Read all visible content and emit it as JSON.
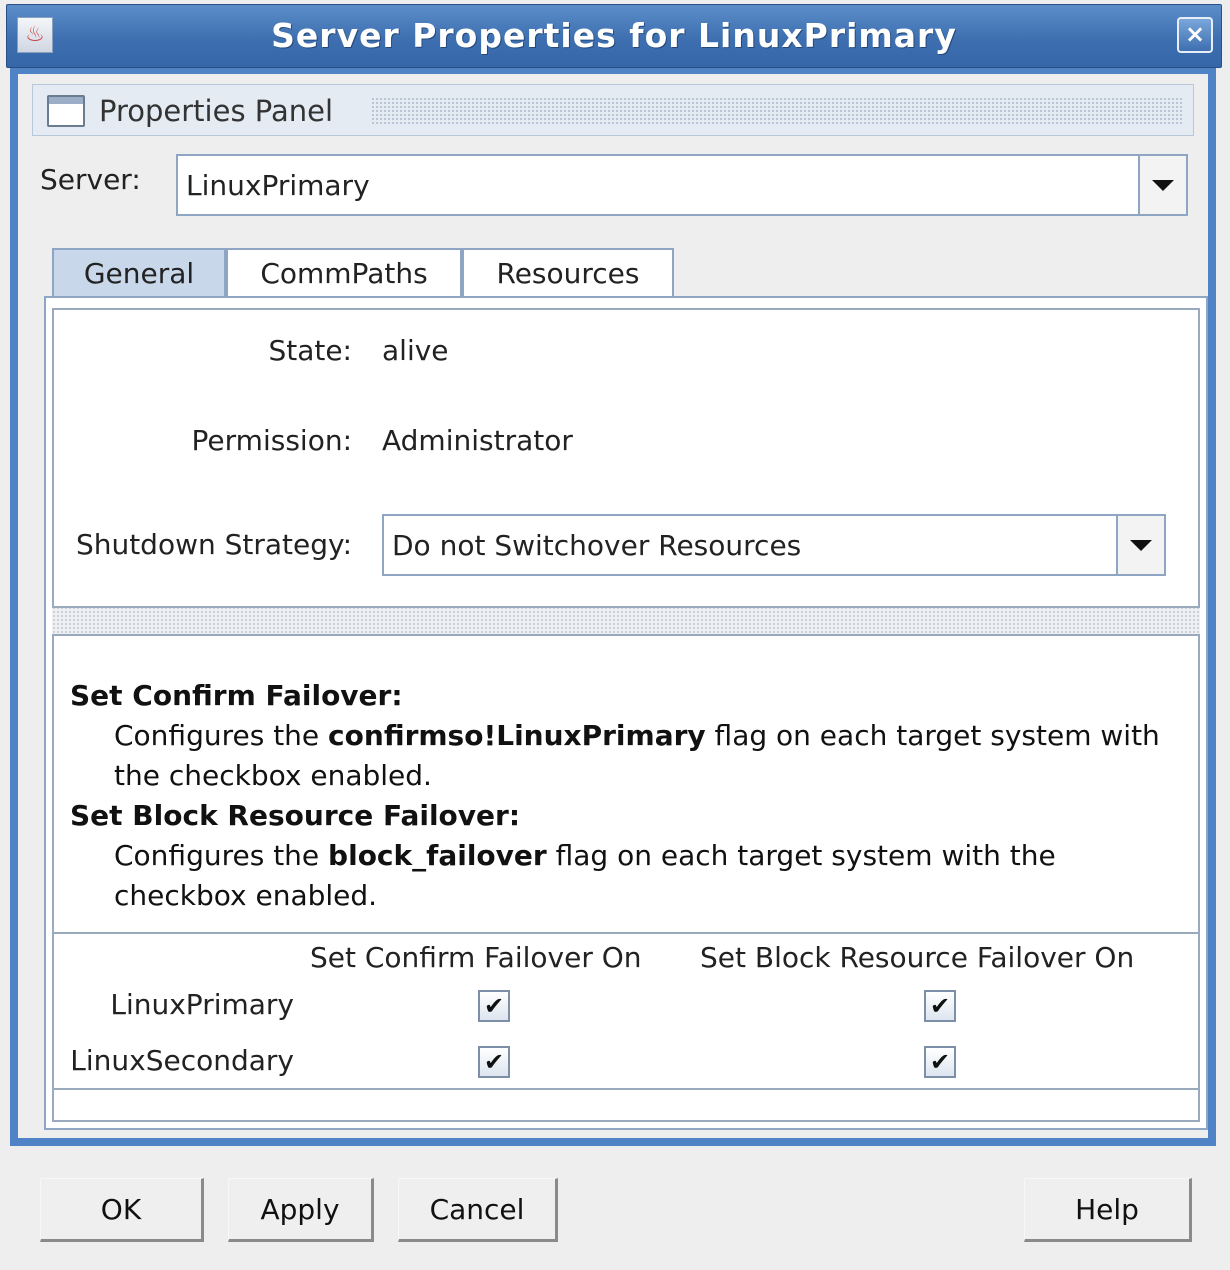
{
  "window": {
    "title": "Server Properties for LinuxPrimary",
    "close_glyph": "×",
    "app_icon": "java-cup-icon"
  },
  "panel": {
    "title": "Properties Panel"
  },
  "server": {
    "label": "Server:",
    "value": "LinuxPrimary"
  },
  "tabs": [
    {
      "label": "General",
      "active": true
    },
    {
      "label": "CommPaths",
      "active": false
    },
    {
      "label": "Resources",
      "active": false
    }
  ],
  "general": {
    "state_label": "State:",
    "state_value": "alive",
    "permission_label": "Permission:",
    "permission_value": "Administrator",
    "shutdown_label": "Shutdown Strategy:",
    "shutdown_value": "Do not Switchover Resources"
  },
  "help": {
    "confirm_heading": "Set Confirm Failover:",
    "confirm_pre": "Configures the ",
    "confirm_flag": "confirmso!LinuxPrimary",
    "confirm_post": " flag on each target system with the checkbox enabled.",
    "block_heading": "Set Block Resource Failover:",
    "block_pre": "Configures the ",
    "block_flag": "block_failover",
    "block_post": " flag on each target system with the checkbox enabled."
  },
  "failover_table": {
    "columns": [
      "Set Confirm Failover On",
      "Set Block Resource Failover On"
    ],
    "rows": [
      {
        "server": "LinuxPrimary",
        "confirm": true,
        "block": true
      },
      {
        "server": "LinuxSecondary",
        "confirm": true,
        "block": true
      }
    ],
    "check_glyph": "✔"
  },
  "buttons": {
    "ok": "OK",
    "apply": "Apply",
    "cancel": "Cancel",
    "help": "Help"
  },
  "colors": {
    "title_bar": "#3e6fb0",
    "frame": "#4f83c6",
    "active_tab": "#c8d8ea"
  }
}
